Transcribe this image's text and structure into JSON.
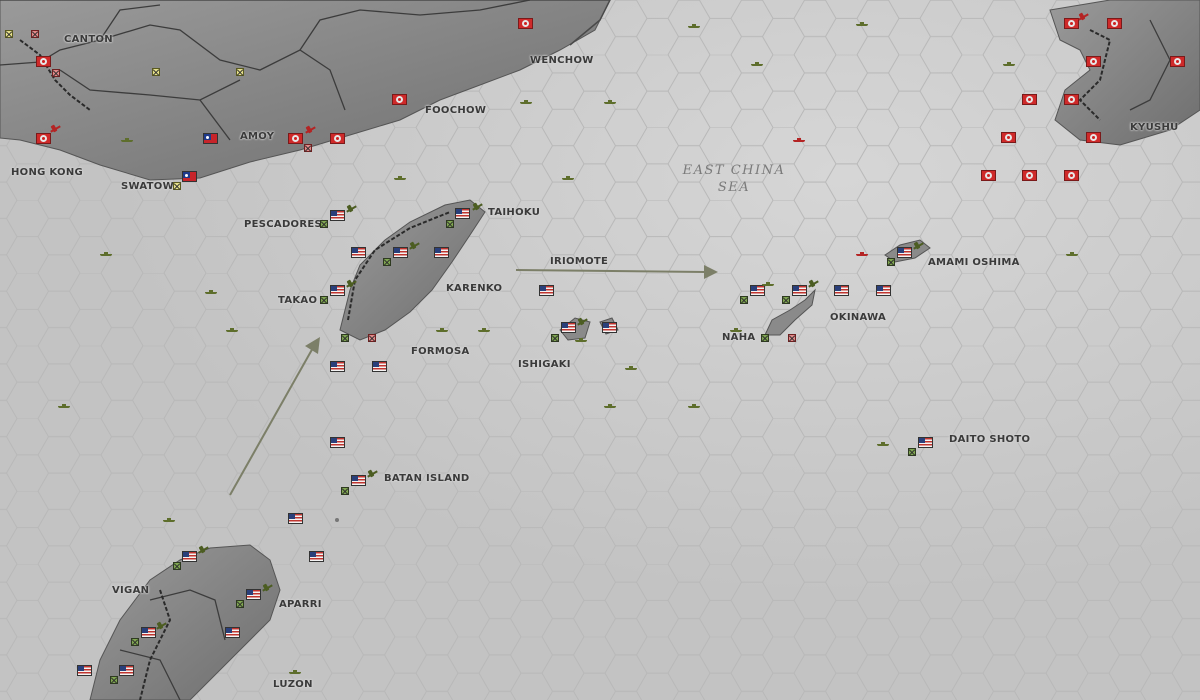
{
  "labels": {
    "canton": "CANTON",
    "wenchow": "WENCHOW",
    "foochow": "FOOCHOW",
    "amoy": "AMOY",
    "hong_kong": "HONG KONG",
    "swatow": "SWATOW",
    "pescadores": "PESCADORES",
    "taihoku": "TAIHOKU",
    "takao": "TAKAO",
    "karenko": "KARENKO",
    "formosa": "FORMOSA",
    "iriomote": "IRIOMOTE",
    "ishigaki": "ISHIGAKI",
    "amami_oshima": "AMAMI OSHIMA",
    "okinawa": "OKINAWA",
    "naha": "NAHA",
    "kyushu": "KYUSHU",
    "daito_shoto": "DAITO SHOTO",
    "batan_island": "BATAN ISLAND",
    "vigan": "VIGAN",
    "aparri": "APARRI",
    "luzon": "LUZON"
  },
  "sea_label": {
    "line1": "EAST CHINA",
    "line2": "SEA"
  },
  "colors": {
    "sea": "#c7c7c7",
    "land": "#8a8a8a",
    "hex_grid": "#b9b9b9",
    "arrow": "#7c7f68",
    "us_unit": "#7fa650",
    "jp_unit": "#e28989",
    "cn_unit": "#e5e08a"
  },
  "icons": [
    "us-flag-icon",
    "japan-flag-icon",
    "china-flag-icon",
    "infantry-unit-icon",
    "warship-icon",
    "aircraft-icon"
  ]
}
